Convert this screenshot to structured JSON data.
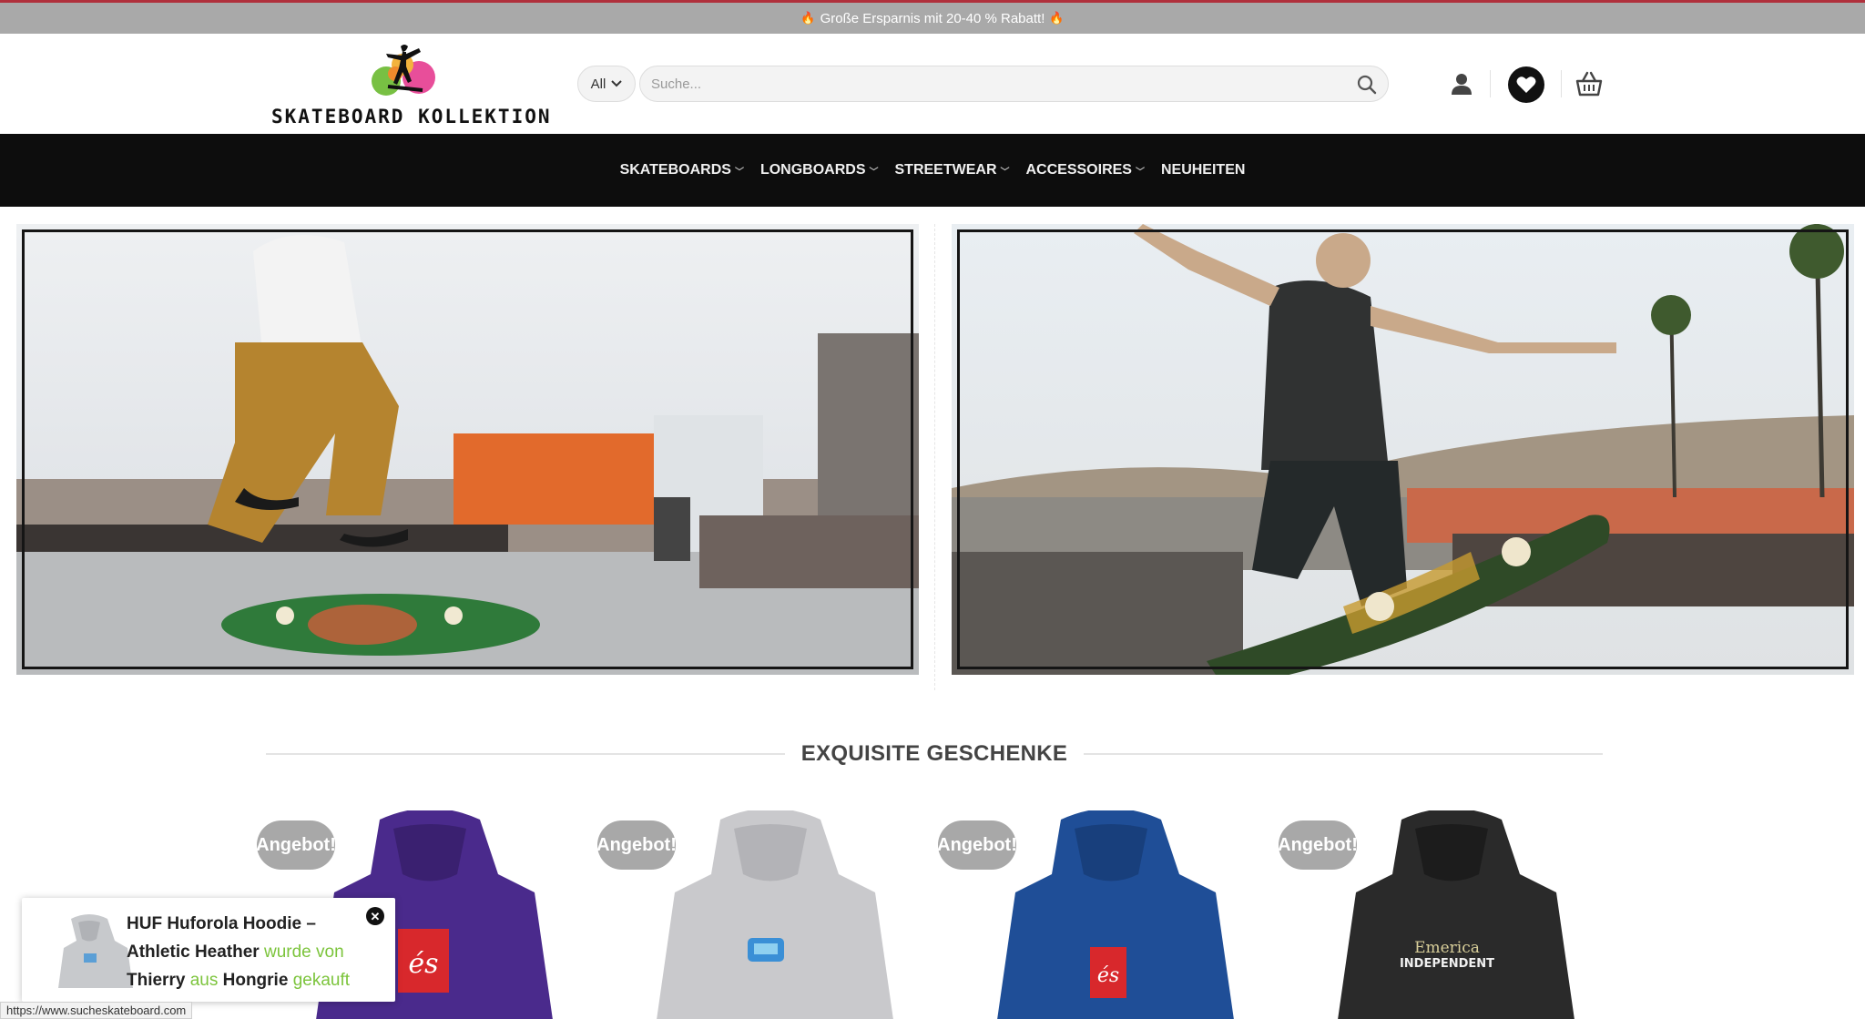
{
  "promo": {
    "text": "Große Ersparnis mit 20-40 % Rabatt!",
    "icon": "flame-icon"
  },
  "header": {
    "logo_text": "SKATEBOARD KOLLEKTION",
    "category_select": "All",
    "search_placeholder": "Suche...",
    "icons": [
      "search-icon",
      "user-icon",
      "heart-icon",
      "basket-icon"
    ]
  },
  "nav": {
    "items": [
      {
        "label": "SKATEBOARDS",
        "has_dropdown": true
      },
      {
        "label": "LONGBOARDS",
        "has_dropdown": true
      },
      {
        "label": "STREETWEAR",
        "has_dropdown": true
      },
      {
        "label": "ACCESSOIRES",
        "has_dropdown": true
      },
      {
        "label": "NEUHEITEN",
        "has_dropdown": false
      }
    ]
  },
  "section": {
    "title": "EXQUISITE GESCHENKE"
  },
  "products": [
    {
      "badge": "Angebot!",
      "color": "#4a2a8c"
    },
    {
      "badge": "Angebot!",
      "color": "#c9c9cc"
    },
    {
      "badge": "Angebot!",
      "color": "#1f4e97"
    },
    {
      "badge": "Angebot!",
      "color": "#2a2a2a"
    }
  ],
  "popup": {
    "product": "HUF Huforola Hoodie – Athletic Heather",
    "word_by": "wurde von",
    "name": "Thierry",
    "word_from": "aus",
    "country": "Hongrie",
    "word_bought": "gekauft"
  },
  "status_url": "https://www.sucheskateboard.com",
  "colors": {
    "accent_green": "#7cc43c",
    "nav_bg": "#0d0d0d",
    "promo_bg": "#a9a9a9",
    "badge_bg": "#a8a8a8"
  }
}
